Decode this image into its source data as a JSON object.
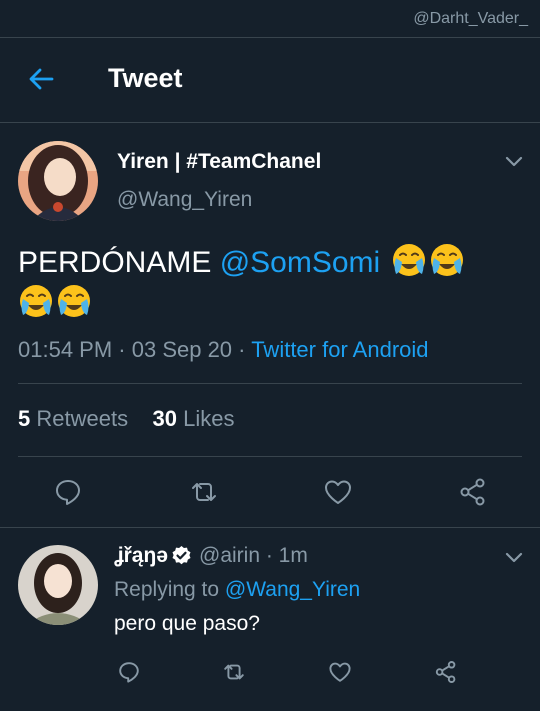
{
  "watermark": "@Darht_Vader_",
  "header": {
    "title": "Tweet"
  },
  "tweet": {
    "author_name": "Yiren | #TeamChanel",
    "author_handle": "@Wang_Yiren",
    "text_prefix": "PERDÓNAME ",
    "mention": "@SomSomi",
    "emojis": [
      "loudly-crying-face",
      "loudly-crying-face",
      "loudly-crying-face",
      "loudly-crying-face"
    ],
    "time": "01:54 PM",
    "date": "03 Sep 20",
    "separator": " · ",
    "source": "Twitter for Android",
    "retweets_count": "5",
    "retweets_label": "Retweets",
    "likes_count": "30",
    "likes_label": "Likes"
  },
  "reply": {
    "name": "ʝřąŋə",
    "handle": "@airin",
    "time_ago": "· 1m",
    "replying_label": "Replying to",
    "replying_to": "@Wang_Yiren",
    "text": "pero que paso?"
  },
  "colors": {
    "background": "#15202b",
    "accent": "#1da1f2",
    "secondary_text": "#8899a6",
    "divider": "#38444d"
  }
}
